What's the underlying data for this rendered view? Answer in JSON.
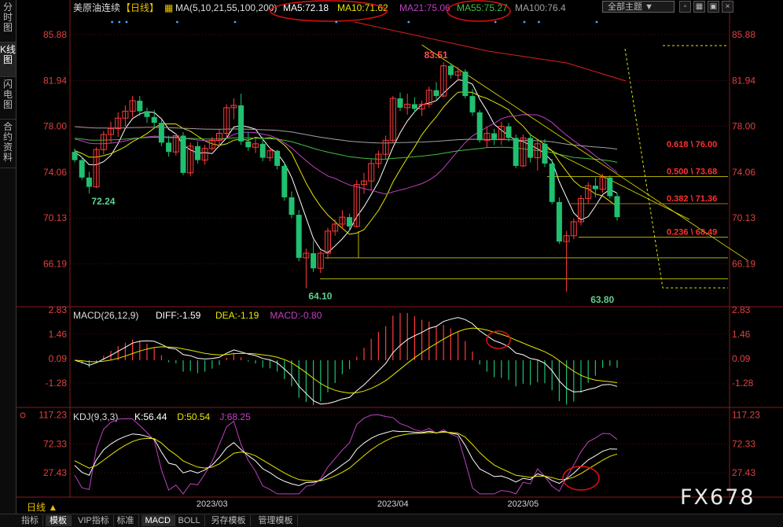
{
  "sidebar": {
    "tabs": [
      {
        "label": "分时图",
        "active": false
      },
      {
        "label": "K线图",
        "active": true
      },
      {
        "label": "闪电图",
        "active": false
      },
      {
        "label": "合约资料",
        "active": false
      }
    ]
  },
  "header": {
    "instrument": "美原油连续",
    "period": "【日线】",
    "ma_label": "MA(5,10,21,55,100,200)",
    "ma_values": [
      {
        "text": "MA5:72.18",
        "color": "#ffffff"
      },
      {
        "text": "MA10:71.62",
        "color": "#e6e600"
      },
      {
        "text": "MA21:75.06",
        "color": "#c040c0"
      },
      {
        "text": "MA55:75.27",
        "color": "#40c040"
      },
      {
        "text": "MA100:76.4",
        "color": "#a0a0a0"
      }
    ],
    "theme_button": "全部主题",
    "theme_arrow": "▼"
  },
  "bottom_bar": {
    "period_selector": "日线 ▲",
    "tabs": [
      "指标",
      "模板",
      "VIP指标",
      "标准",
      "MACD",
      "BOLL",
      "另存模板",
      "管理模板"
    ],
    "active_tabs": [
      1,
      4
    ]
  },
  "watermark": "FX678",
  "colors": {
    "up": "#ff3b3b",
    "down": "#20c070",
    "bg": "#000000",
    "grid": "#8a1a1a",
    "axis_text": "#e04040"
  },
  "chart_data": [
    {
      "type": "candlestick",
      "title": "美原油连续【日线】",
      "y_ticks": [
        "85.88",
        "81.94",
        "78.00",
        "74.06",
        "70.13",
        "66.19"
      ],
      "ylim": [
        62.5,
        87.5
      ],
      "x_ticks": [
        "2023/03",
        "2023/04",
        "2023/05"
      ],
      "x_tick_index": [
        19,
        44,
        62
      ],
      "annotations": [
        {
          "text": "72.24",
          "index": 2,
          "value": 72.24
        },
        {
          "text": "64.10",
          "index": 32,
          "value": 64.1
        },
        {
          "text": "83.51",
          "index": 48,
          "value": 83.51
        },
        {
          "text": "63.80",
          "index": 71,
          "value": 63.8
        }
      ],
      "fibonacci": [
        {
          "text": "0.618 \\ 76.00",
          "value": 76.0
        },
        {
          "text": "0.500 \\ 73.68",
          "value": 73.68
        },
        {
          "text": "0.382 \\ 71.36",
          "value": 71.36
        },
        {
          "text": "0.236 \\ 68.49",
          "value": 68.49
        }
      ],
      "ohlc": [
        [
          75.8,
          76.1,
          74.9,
          75.1
        ],
        [
          75.1,
          75.4,
          73.4,
          73.6
        ],
        [
          73.6,
          74.1,
          72.24,
          72.8
        ],
        [
          72.8,
          76.2,
          72.7,
          76.0
        ],
        [
          76.0,
          77.6,
          75.6,
          77.3
        ],
        [
          77.3,
          78.4,
          76.6,
          77.8
        ],
        [
          77.8,
          79.2,
          77.1,
          78.7
        ],
        [
          78.7,
          79.8,
          78.0,
          79.3
        ],
        [
          79.3,
          80.6,
          78.8,
          80.2
        ],
        [
          80.2,
          80.6,
          78.9,
          79.3
        ],
        [
          79.3,
          79.6,
          78.3,
          78.8
        ],
        [
          78.8,
          79.4,
          77.9,
          78.3
        ],
        [
          78.3,
          78.6,
          76.3,
          76.6
        ],
        [
          76.6,
          77.2,
          75.4,
          75.8
        ],
        [
          75.8,
          77.4,
          75.5,
          77.2
        ],
        [
          77.2,
          77.5,
          73.8,
          74.0
        ],
        [
          74.0,
          76.6,
          73.7,
          76.3
        ],
        [
          76.3,
          76.7,
          74.8,
          75.1
        ],
        [
          75.1,
          76.4,
          74.7,
          76.1
        ],
        [
          76.1,
          77.1,
          75.9,
          76.8
        ],
        [
          76.8,
          77.8,
          76.2,
          77.4
        ],
        [
          77.4,
          79.9,
          77.0,
          79.6
        ],
        [
          79.6,
          80.4,
          78.6,
          79.8
        ],
        [
          79.8,
          80.8,
          76.4,
          76.7
        ],
        [
          76.7,
          77.5,
          75.9,
          76.2
        ],
        [
          76.2,
          77.0,
          75.7,
          76.5
        ],
        [
          76.5,
          77.1,
          75.0,
          75.3
        ],
        [
          75.3,
          76.2,
          75.0,
          75.9
        ],
        [
          75.9,
          76.0,
          74.3,
          74.6
        ],
        [
          74.6,
          74.9,
          71.6,
          71.9
        ],
        [
          71.9,
          72.4,
          70.1,
          70.4
        ],
        [
          70.4,
          70.8,
          66.4,
          66.7
        ],
        [
          66.7,
          67.5,
          64.1,
          67.1
        ],
        [
          67.1,
          68.2,
          65.5,
          65.8
        ],
        [
          65.8,
          67.3,
          65.4,
          67.1
        ],
        [
          67.1,
          69.3,
          66.6,
          69.0
        ],
        [
          69.0,
          70.0,
          68.6,
          69.6
        ],
        [
          69.6,
          70.8,
          69.2,
          70.2
        ],
        [
          70.2,
          70.5,
          69.0,
          69.4
        ],
        [
          69.4,
          73.4,
          69.3,
          73.0
        ],
        [
          73.0,
          74.0,
          72.2,
          73.3
        ],
        [
          73.3,
          75.2,
          72.5,
          74.8
        ],
        [
          74.8,
          75.9,
          74.4,
          75.6
        ],
        [
          75.6,
          77.2,
          75.2,
          76.8
        ],
        [
          76.8,
          80.6,
          76.6,
          80.4
        ],
        [
          80.4,
          80.9,
          79.3,
          79.6
        ],
        [
          79.6,
          80.8,
          79.0,
          79.9
        ],
        [
          79.9,
          80.5,
          79.2,
          79.5
        ],
        [
          79.5,
          80.2,
          78.9,
          79.9
        ],
        [
          79.9,
          81.4,
          79.6,
          81.1
        ],
        [
          81.1,
          81.8,
          80.3,
          80.6
        ],
        [
          80.6,
          83.51,
          80.5,
          83.2
        ],
        [
          83.2,
          83.4,
          82.1,
          82.4
        ],
        [
          82.4,
          83.1,
          81.9,
          82.7
        ],
        [
          82.7,
          82.9,
          80.4,
          80.6
        ],
        [
          80.6,
          81.2,
          78.9,
          79.2
        ],
        [
          79.2,
          79.4,
          76.6,
          76.8
        ],
        [
          76.8,
          78.0,
          76.2,
          77.4
        ],
        [
          77.4,
          77.8,
          76.4,
          76.9
        ],
        [
          76.9,
          78.4,
          76.4,
          78.0
        ],
        [
          78.0,
          78.3,
          76.7,
          77.0
        ],
        [
          77.0,
          77.3,
          74.4,
          74.6
        ],
        [
          74.6,
          77.3,
          74.5,
          77.0
        ],
        [
          77.0,
          77.4,
          74.9,
          75.3
        ],
        [
          75.3,
          76.7,
          74.2,
          76.5
        ],
        [
          76.5,
          76.9,
          74.5,
          74.8
        ],
        [
          74.8,
          75.2,
          71.3,
          71.5
        ],
        [
          71.5,
          71.9,
          67.9,
          68.1
        ],
        [
          68.1,
          69.0,
          63.8,
          68.6
        ],
        [
          68.6,
          70.1,
          68.3,
          69.8
        ],
        [
          69.8,
          72.1,
          69.5,
          71.8
        ],
        [
          71.8,
          73.2,
          71.4,
          72.9
        ],
        [
          72.9,
          73.6,
          71.9,
          72.6
        ],
        [
          72.6,
          73.9,
          72.3,
          73.6
        ],
        [
          73.6,
          73.8,
          71.8,
          72.0
        ],
        [
          72.0,
          72.3,
          69.9,
          70.2
        ]
      ]
    },
    {
      "type": "bar",
      "title": "MACD(26,12,9)",
      "legend": [
        {
          "text": "DIFF:-1.59",
          "color": "#ffffff"
        },
        {
          "text": "DEA:-1.19",
          "color": "#e6e600"
        },
        {
          "text": "MACD:-0.80",
          "color": "#c040c0"
        }
      ],
      "y_ticks": [
        "2.83",
        "1.46",
        "0.09",
        "-1.28"
      ],
      "ylim": [
        -2.65,
        2.83
      ]
    },
    {
      "type": "line",
      "title": "KDJ(9,3,3)",
      "legend": [
        {
          "text": "K:56.44",
          "color": "#ffffff"
        },
        {
          "text": "D:50.54",
          "color": "#e6e600"
        },
        {
          "text": "J:68.25",
          "color": "#c040c0"
        }
      ],
      "y_ticks": [
        "117.23",
        "72.33",
        "27.43"
      ],
      "ylim": [
        -10,
        125
      ]
    }
  ]
}
